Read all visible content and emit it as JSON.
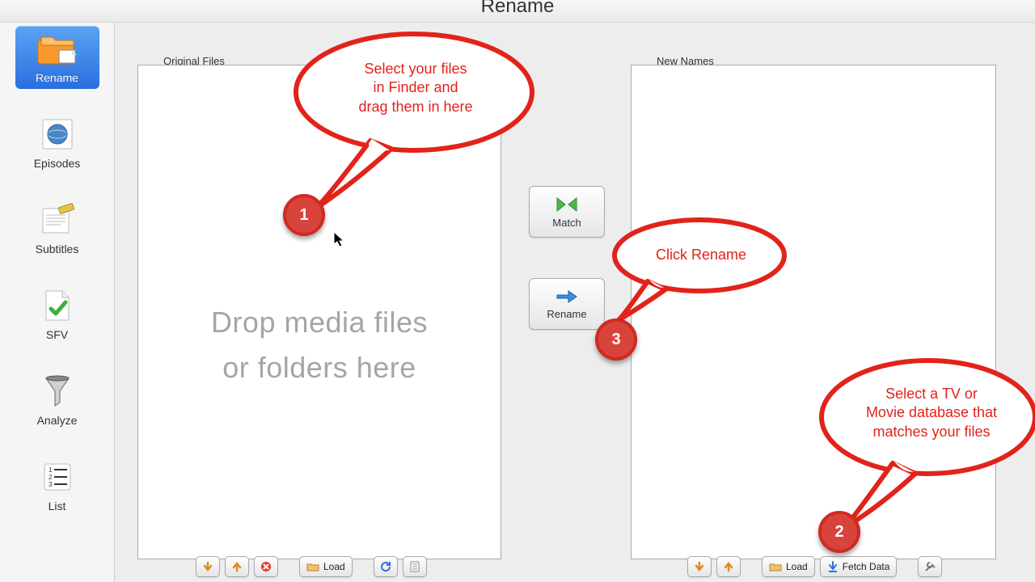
{
  "window": {
    "title": "Rename"
  },
  "sidebar": {
    "items": [
      {
        "label": "Rename"
      },
      {
        "label": "Episodes"
      },
      {
        "label": "Subtitles"
      },
      {
        "label": "SFV"
      },
      {
        "label": "Analyze"
      },
      {
        "label": "List"
      }
    ]
  },
  "panels": {
    "left_label": "Original Files",
    "right_label": "New Names",
    "drop_hint_line1": "Drop media files",
    "drop_hint_line2": "or folders here"
  },
  "center": {
    "match_label": "Match",
    "rename_label": "Rename"
  },
  "toolbar": {
    "load_label": "Load",
    "fetch_label": "Fetch Data"
  },
  "callouts": {
    "one": {
      "number": "1",
      "line1": "Select your files",
      "line2": "in Finder and",
      "line3": "drag them in here"
    },
    "two": {
      "number": "2",
      "line1": "Select a TV or",
      "line2": "Movie database that",
      "line3": "matches your files"
    },
    "three": {
      "number": "3",
      "line1": "Click Rename"
    }
  },
  "colors": {
    "callout_red": "#e2231a",
    "badge_fill": "#d8443c",
    "active_blue": "#2a6ee0"
  }
}
